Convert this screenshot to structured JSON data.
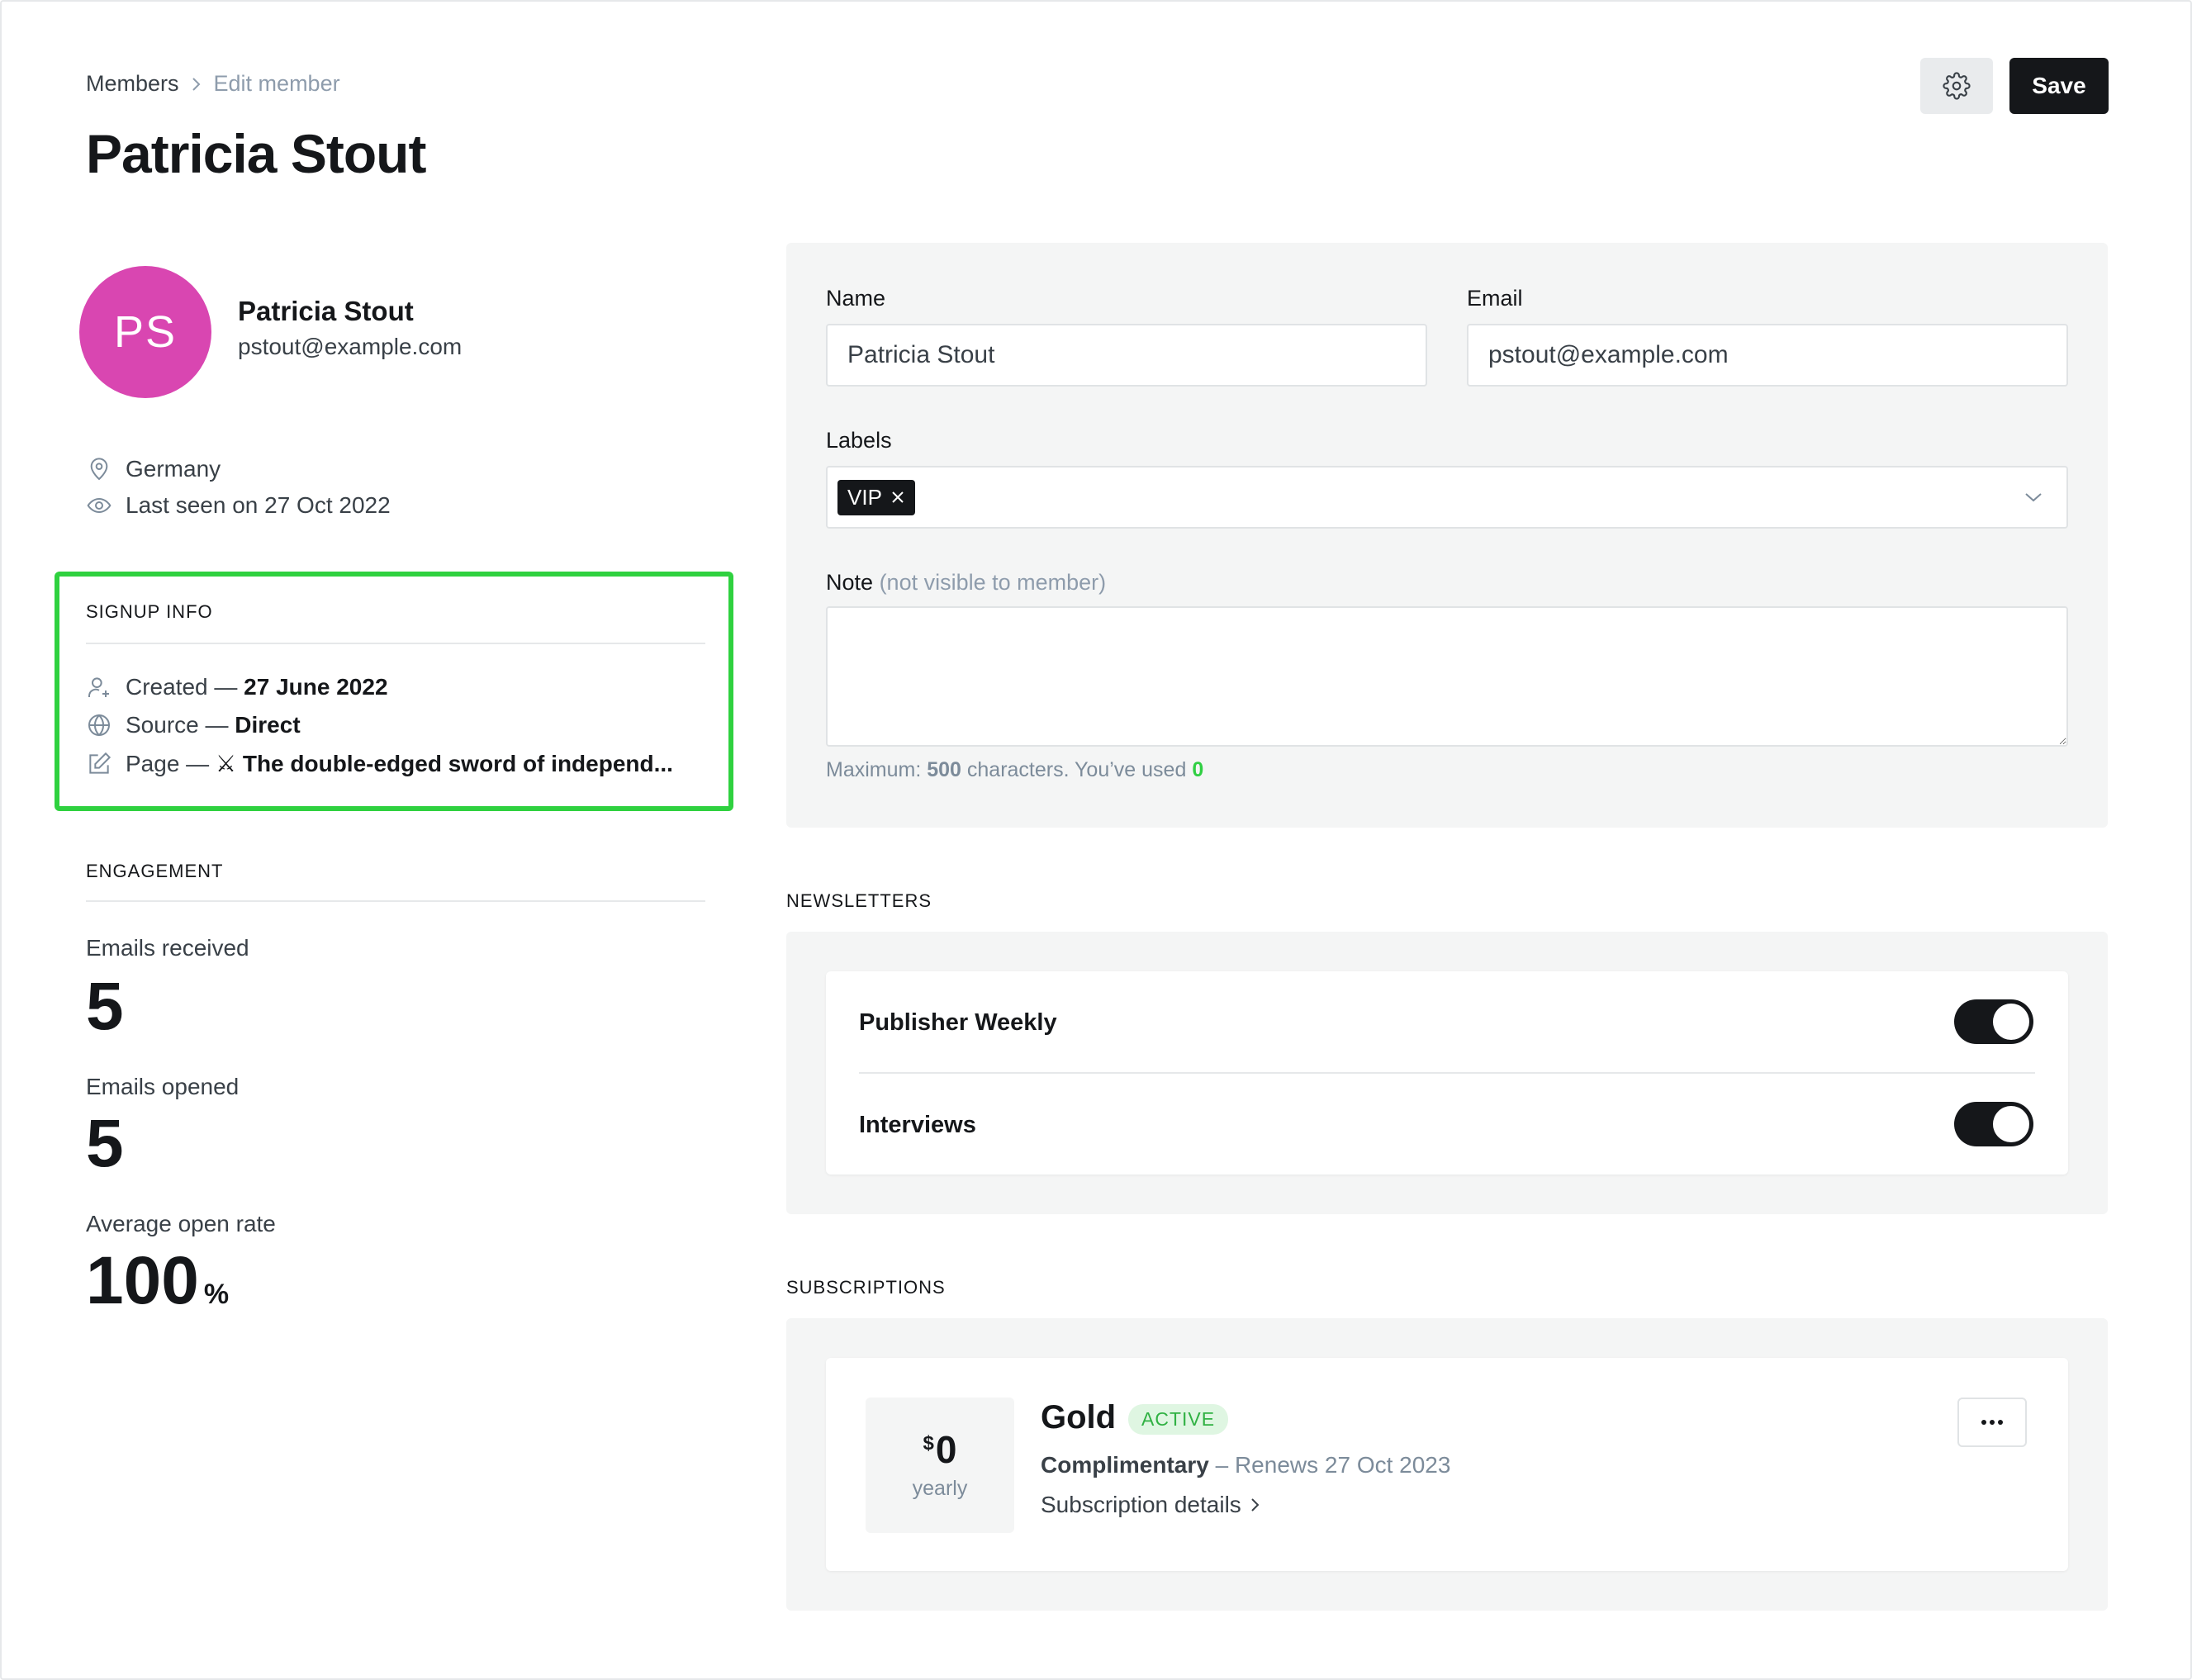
{
  "breadcrumb": {
    "parent": "Members",
    "current": "Edit member"
  },
  "page_title": "Patricia Stout",
  "header_actions": {
    "settings_icon": "gear-icon",
    "save_label": "Save"
  },
  "profile": {
    "initials": "PS",
    "avatar_color": "#d946b1",
    "name": "Patricia Stout",
    "email": "pstout@example.com",
    "location": "Germany",
    "last_seen": "Last seen on 27 Oct 2022"
  },
  "signup_info": {
    "title": "SIGNUP INFO",
    "highlight_color": "#2fd13f",
    "created_label": "Created — ",
    "created_value": "27 June 2022",
    "source_label": "Source — ",
    "source_value": "Direct",
    "page_label": "Page — ",
    "page_value": "⚔ The double-edged sword of independ..."
  },
  "engagement": {
    "title": "ENGAGEMENT",
    "emails_received_label": "Emails received",
    "emails_received_value": "5",
    "emails_opened_label": "Emails opened",
    "emails_opened_value": "5",
    "open_rate_label": "Average open rate",
    "open_rate_value": "100",
    "open_rate_unit": "%"
  },
  "form": {
    "name_label": "Name",
    "name_value": "Patricia Stout",
    "email_label": "Email",
    "email_value": "pstout@example.com",
    "labels_label": "Labels",
    "labels": [
      "VIP"
    ],
    "note_label": "Note",
    "note_hint": "(not visible to member)",
    "note_value": "",
    "help_prefix": "Maximum: ",
    "help_max": "500",
    "help_middle": " characters. You’ve used ",
    "help_used": "0"
  },
  "newsletters": {
    "title": "NEWSLETTERS",
    "items": [
      {
        "name": "Publisher Weekly",
        "enabled": true
      },
      {
        "name": "Interviews",
        "enabled": true
      }
    ]
  },
  "subscriptions": {
    "title": "SUBSCRIPTIONS",
    "currency": "$",
    "price": "0",
    "period": "yearly",
    "tier": "Gold",
    "status": "ACTIVE",
    "type": "Complimentary",
    "renews": " – Renews 27 Oct 2023",
    "details_link": "Subscription details"
  }
}
